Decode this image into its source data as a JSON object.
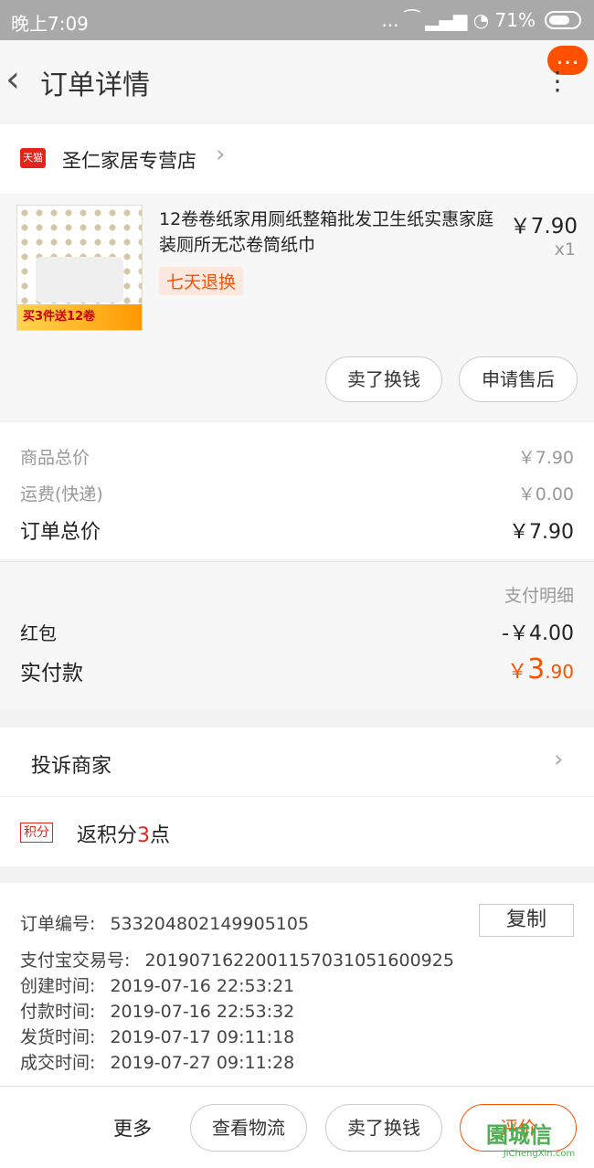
{
  "statusbar": {
    "time": "晚上7:09",
    "right": "... ⁀ ▂▄▆ ◔ 71%"
  },
  "nav": {
    "back": "‹",
    "title": "订单详情",
    "more": "…",
    "kebab": "⋮"
  },
  "store": {
    "badge": "天猫",
    "name": "圣仁家居专营店",
    "chev": "›"
  },
  "product": {
    "title": "12卷卷纸家用厕纸整箱批发卫生纸实惠家庭装厕所无芯卷筒纸巾",
    "price": "￥7.90",
    "qty": "x1",
    "tag": "七天退换",
    "thumb_tag": "买3件送12卷",
    "sell_button": "卖了换钱",
    "after_sale_button": "申请售后"
  },
  "summary": {
    "goods_label": "商品总价",
    "goods_value": "￥7.90",
    "ship_label": "运费(快递)",
    "ship_value": "￥0.00",
    "total_label": "订单总价",
    "total_value": "￥7.90"
  },
  "payment": {
    "detail_link": "支付明细",
    "redpack_label": "红包",
    "redpack_value": "-￥4.00",
    "paid_label": "实付款",
    "paid_symbol": "￥",
    "paid_int": "3",
    "paid_dec": ".90"
  },
  "complain": {
    "label": "投诉商家",
    "chev": "›"
  },
  "points": {
    "badge": "积分",
    "text_prefix": "返积分",
    "num": "3",
    "text_suffix": "点"
  },
  "info": {
    "order_no_label": "订单编号:",
    "order_no": "533204802149905105",
    "copy_button": "复制",
    "alipay_label": "支付宝交易号:",
    "alipay_no": "2019071622001157031051600925",
    "create_label": "创建时间:",
    "create_time": "2019-07-16 22:53:21",
    "pay_label": "付款时间:",
    "pay_time": "2019-07-16 22:53:32",
    "ship_label": "发货时间:",
    "ship_time": "2019-07-17 09:11:18",
    "done_label": "成交时间:",
    "done_time": "2019-07-27 09:11:28"
  },
  "bottom": {
    "more": "更多",
    "logistics": "查看物流",
    "sell": "卖了换钱",
    "review": "评价"
  },
  "watermark": {
    "cn": "園城信",
    "en": "JiChengXin.com"
  },
  "colors": {
    "accent": "#ff5000",
    "tmall": "#e1251b"
  }
}
